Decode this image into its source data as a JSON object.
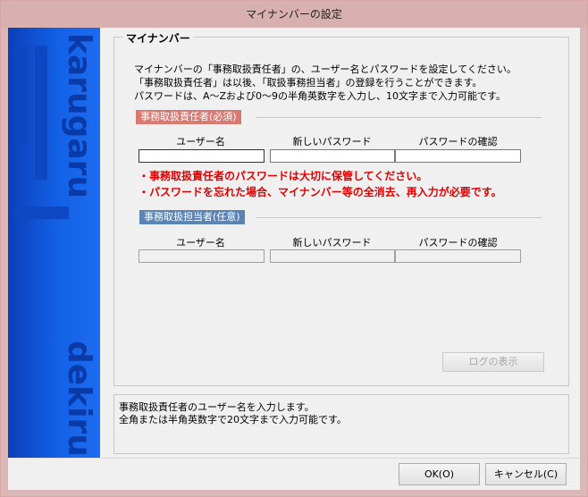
{
  "window": {
    "title": "マイナンバーの設定"
  },
  "banner": {
    "word_top": "karugaru",
    "word_bottom": "dekiru"
  },
  "group": {
    "title": "マイナンバー",
    "description": [
      "マイナンバーの「事務取扱責任者」の、ユーザー名とパスワードを設定してください。",
      "「事務取扱責任者」は以後、「取扱事務担当者」の登録を行うことができます。",
      "パスワードは、A～Zおよび0～9の半角英数字を入力し、10文字まで入力可能です。"
    ],
    "responsible": {
      "label": "事務取扱責任者(必須)",
      "color": "#d97a72",
      "col_username": "ユーザー名",
      "col_new_password": "新しいパスワード",
      "col_confirm": "パスワードの確認",
      "username": "",
      "new_password": "",
      "confirm": ""
    },
    "warnings": [
      "・事務取扱責任者のパスワードは大切に保管してください。",
      "・パスワードを忘れた場合、マイナンバー等の全消去、再入力が必要です。"
    ],
    "staff": {
      "label": "事務取扱担当者(任意)",
      "color": "#5a84b4",
      "col_username": "ユーザー名",
      "col_new_password": "新しいパスワード",
      "col_confirm": "パスワードの確認",
      "username": "",
      "new_password": "",
      "confirm": ""
    },
    "log_button": "ログの表示"
  },
  "help": {
    "lines": [
      "事務取扱責任者のユーザー名を入力します。",
      "全角または半角英数字で20文字まで入力可能です。"
    ]
  },
  "footer": {
    "ok": "OK(O)",
    "cancel": "キャンセル(C)"
  }
}
